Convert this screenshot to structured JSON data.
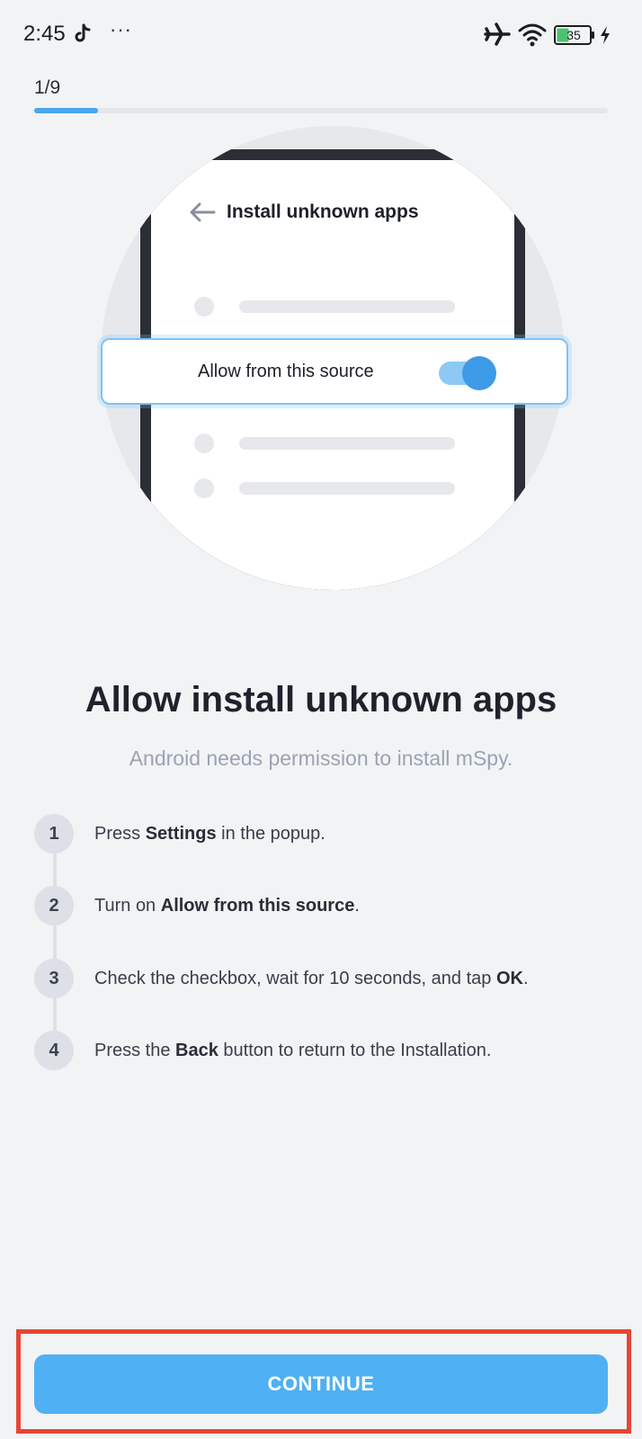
{
  "status_bar": {
    "time": "2:45",
    "more": "···",
    "battery": "35"
  },
  "progress": {
    "label": "1/9",
    "fraction": 0.111
  },
  "illustration": {
    "screen_title": "Install unknown apps",
    "toggle_label": "Allow from this source",
    "toggle_on": true
  },
  "content": {
    "heading": "Allow install unknown apps",
    "subtitle": "Android needs permission to install mSpy.",
    "steps": [
      {
        "number": "1",
        "pre": "Press ",
        "bold": "Settings",
        "post": " in the popup."
      },
      {
        "number": "2",
        "pre": "Turn on ",
        "bold": "Allow from this source",
        "post": "."
      },
      {
        "number": "3",
        "pre": "Check the checkbox, wait for 10 seconds, and tap ",
        "bold": "OK",
        "post": "."
      },
      {
        "number": "4",
        "pre": "Press the ",
        "bold": "Back",
        "post": " button to return to the Installation."
      }
    ]
  },
  "actions": {
    "continue_label": "CONTINUE"
  },
  "colors": {
    "accent": "#4fb0f3",
    "progress": "#4aa6ee",
    "highlight_frame": "#e64535"
  }
}
